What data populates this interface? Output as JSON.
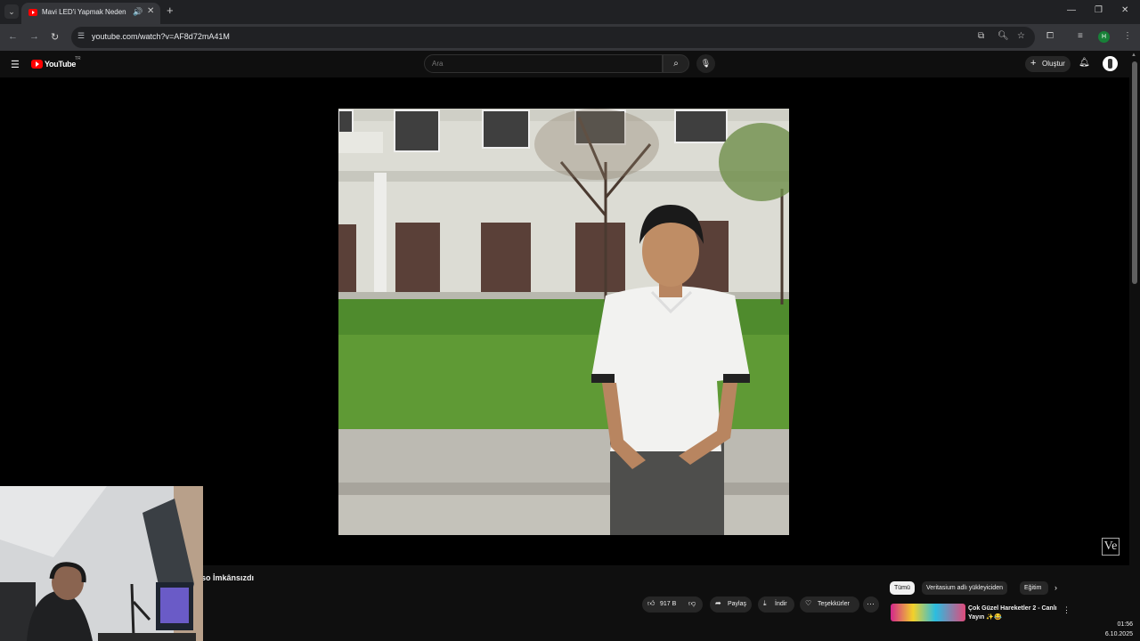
{
  "browser": {
    "tab": {
      "title": "Mavi LED'i Yapmak Neden İmkânsızdı",
      "audio_icon": "speaker-icon"
    },
    "url": "youtube.com/watch?v=AF8d72mA41M",
    "profile_initial": "H"
  },
  "youtube": {
    "logo_text": "YouTube",
    "country_code": "TR",
    "search_placeholder": "Ara",
    "create_label": "Oluştur"
  },
  "video": {
    "title": "so İmkânsızdı",
    "watermark": "Ve"
  },
  "actions": {
    "like_count": "917 B",
    "share_label": "Paylaş",
    "download_label": "İndir",
    "thanks_label": "Teşekkürler",
    "more_label": "···"
  },
  "sidebar": {
    "chips": [
      "Tümü",
      "Veritasium adlı yükleyiciden",
      "Eğitim"
    ],
    "recommendation_title": "Çok Güzel Hareketler 2 - Canlı Yayın ✨😂"
  },
  "taskbar": {
    "time": "01:56",
    "date": "6.10.2025"
  },
  "colors": {
    "youtube_red": "#ff0000",
    "background": "#0f0f0f",
    "pill": "#272727"
  }
}
